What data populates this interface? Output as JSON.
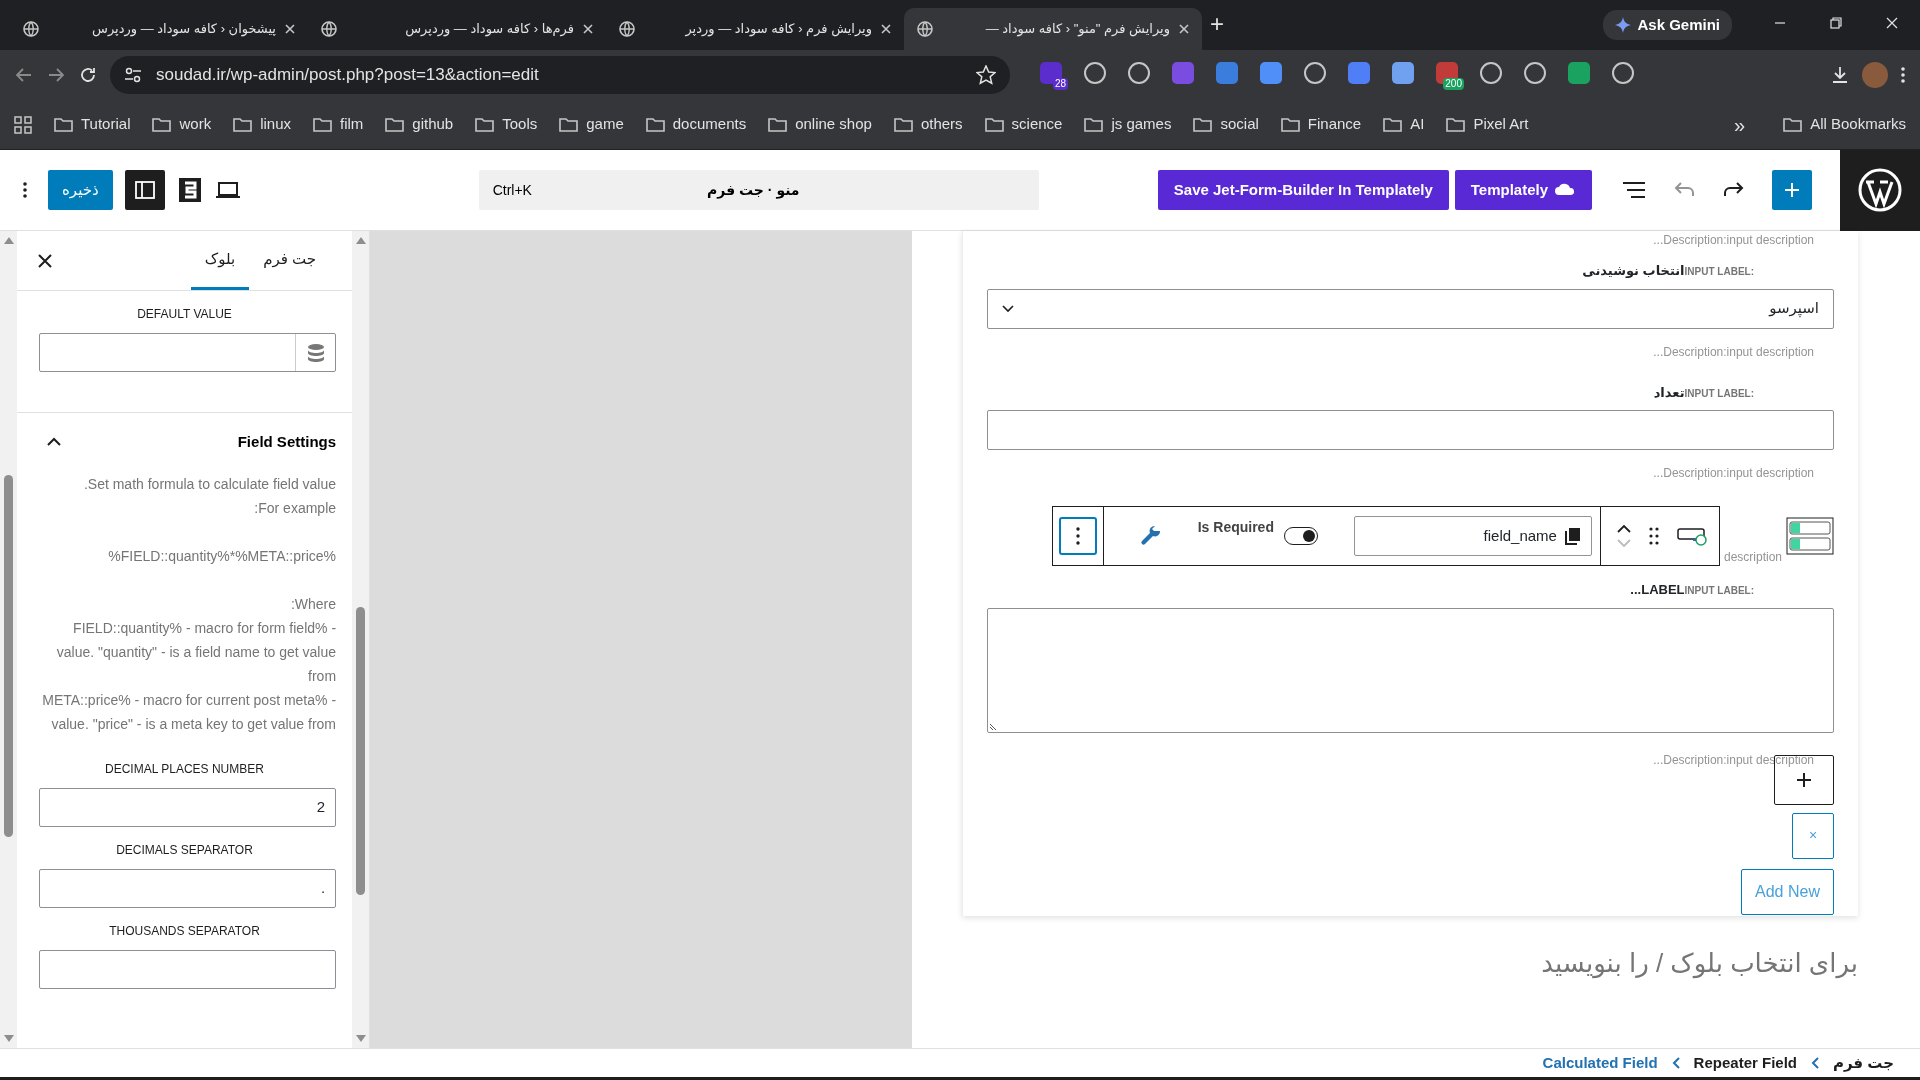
{
  "browser": {
    "tabs": [
      {
        "title": "ویرایش فرم \"منو\" ‹ کافه سوداد —",
        "selected": true
      },
      {
        "title": "ویرایش فرم ‹ کافه سوداد — وردپر",
        "selected": false
      },
      {
        "title": "فرم‌ها ‹ کافه سوداد — وردپرس",
        "selected": false
      },
      {
        "title": "پیشخوان ‹ کافه سوداد — وردپرس",
        "selected": false
      }
    ],
    "new_tab": "+",
    "gemini": "Ask Gemini",
    "url": "soudad.ir/wp-admin/post.php?post=13&action=edit",
    "extension_badges": [
      "28",
      "200"
    ],
    "bookmarks": [
      "Tutorial",
      "work",
      "linux",
      "film",
      "github",
      "Tools",
      "game",
      "documents",
      "online shop",
      "others",
      "science",
      "js games",
      "social",
      "Finance",
      "AI",
      "Pixel Art"
    ],
    "more": "»",
    "all_bookmarks": "All Bookmarks"
  },
  "header": {
    "save": "ذخیره",
    "command": {
      "title": "منو · جت فرم",
      "shortcut": "Ctrl+K"
    },
    "templately_save": "Save Jet-Form-Builder In Templately",
    "templately": "Templately"
  },
  "sidebar": {
    "tabs": [
      {
        "label": "جت فرم",
        "selected": false
      },
      {
        "label": "بلوک",
        "selected": true
      }
    ],
    "default_value": {
      "label": "DEFAULT VALUE"
    },
    "field_settings": {
      "title": "Field Settings",
      "expanded": true,
      "help": [
        {
          "lines": [
            "Set math formula to calculate field value.",
            "For example:"
          ]
        },
        {
          "lines": [
            "%FIELD::quantity%*%META::price%"
          ]
        },
        {
          "lines": [
            "Where:",
            "- %FIELD::quantity% - macro for form field value. \"quantity\" - is a field name to get value from",
            "- %META::price% - macro for current post meta value. \"price\" - is a meta key to get value from"
          ]
        }
      ]
    },
    "fields": [
      {
        "label": "DECIMAL PLACES NUMBER",
        "value": "2"
      },
      {
        "label": "DECIMALS SEPARATOR",
        "value": "."
      },
      {
        "label": "THOUSANDS SEPARATOR"
      }
    ]
  },
  "editor": {
    "top_description": "Description:input description...",
    "fields": [
      {
        "kind": "select",
        "label_prefix": "INPUT LABEL:",
        "label": "انتخاب نوشیدنی",
        "value": "اسپرسو",
        "description": "Description:input description..."
      },
      {
        "kind": "text",
        "label_prefix": "INPUT LABEL:",
        "label": "تعداد",
        "description": "Description:input description..."
      }
    ],
    "block_toolbar": {
      "required_label": "Is Required",
      "required_on": true,
      "field_name": "field_name",
      "partial_description": "description"
    },
    "textarea": {
      "label_prefix": "INPUT LABEL:",
      "label": "LABEL...",
      "description": "Description:input description..."
    },
    "remove": "×",
    "add_new": "Add New",
    "appender_placeholder": "برای انتخاب بلوک / را بنویسید"
  },
  "breadcrumb": [
    {
      "label": "Calculated Field",
      "current": true
    },
    {
      "label": "Repeater Field",
      "current": false
    },
    {
      "label": "جت فرم",
      "current": false
    }
  ]
}
